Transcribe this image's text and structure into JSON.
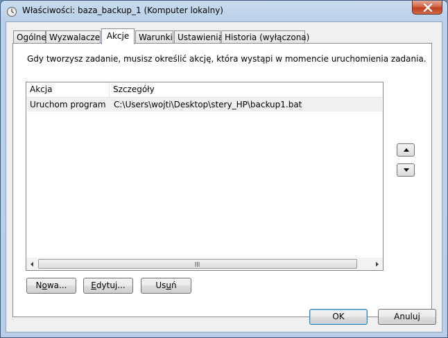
{
  "window": {
    "title": "Właściwości: baza_backup_1 (Komputer lokalny)",
    "icon": "clock-icon",
    "accent_color": "#b9d0e8"
  },
  "tabs": [
    {
      "label": "Ogólne",
      "active": false
    },
    {
      "label": "Wyzwalacze",
      "active": false
    },
    {
      "label": "Akcje",
      "active": true
    },
    {
      "label": "Warunki",
      "active": false
    },
    {
      "label": "Ustawienia",
      "active": false
    },
    {
      "label": "Historia (wyłączona)",
      "active": false
    }
  ],
  "actions_panel": {
    "description": "Gdy tworzysz zadanie, musisz określić akcję, która wystąpi w momencie uruchomienia zadania.",
    "columns": [
      "Akcja",
      "Szczegóły"
    ],
    "rows": [
      {
        "action": "Uruchom program",
        "details": "C:\\Users\\wojti\\Desktop\\stery_HP\\backup1.bat"
      }
    ],
    "buttons": {
      "new": {
        "pre": "N",
        "u": "o",
        "post": "wa..."
      },
      "edit": {
        "pre": "",
        "u": "E",
        "post": "dytuj..."
      },
      "delete": {
        "pre": "Us",
        "u": "u",
        "post": "ń"
      }
    },
    "move_up_icon": "triangle-up-icon",
    "move_down_icon": "triangle-down-icon"
  },
  "footer": {
    "ok_label": "OK",
    "cancel_label": "Anuluj"
  }
}
